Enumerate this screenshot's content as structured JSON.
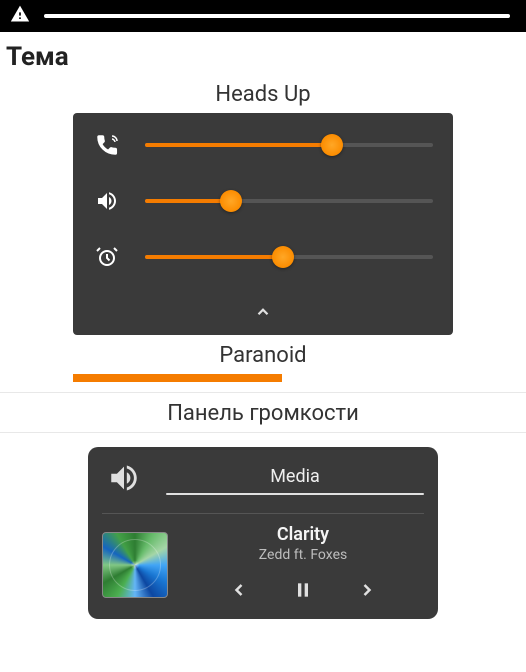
{
  "page": {
    "title": "Тема"
  },
  "sections": {
    "headsup": {
      "label": "Heads Up",
      "sliders": [
        {
          "icon": "ringer",
          "value": 65
        },
        {
          "icon": "sound",
          "value": 30
        },
        {
          "icon": "alarm",
          "value": 48
        }
      ]
    },
    "paranoid": {
      "label": "Paranoid",
      "progress": 55
    },
    "volume_panel": {
      "label": "Панель громкости",
      "media_label": "Media",
      "now_playing": {
        "title": "Clarity",
        "artist": "Zedd ft. Foxes"
      }
    }
  },
  "colors": {
    "accent": "#f57c00",
    "card_bg": "#3a3a3a"
  }
}
